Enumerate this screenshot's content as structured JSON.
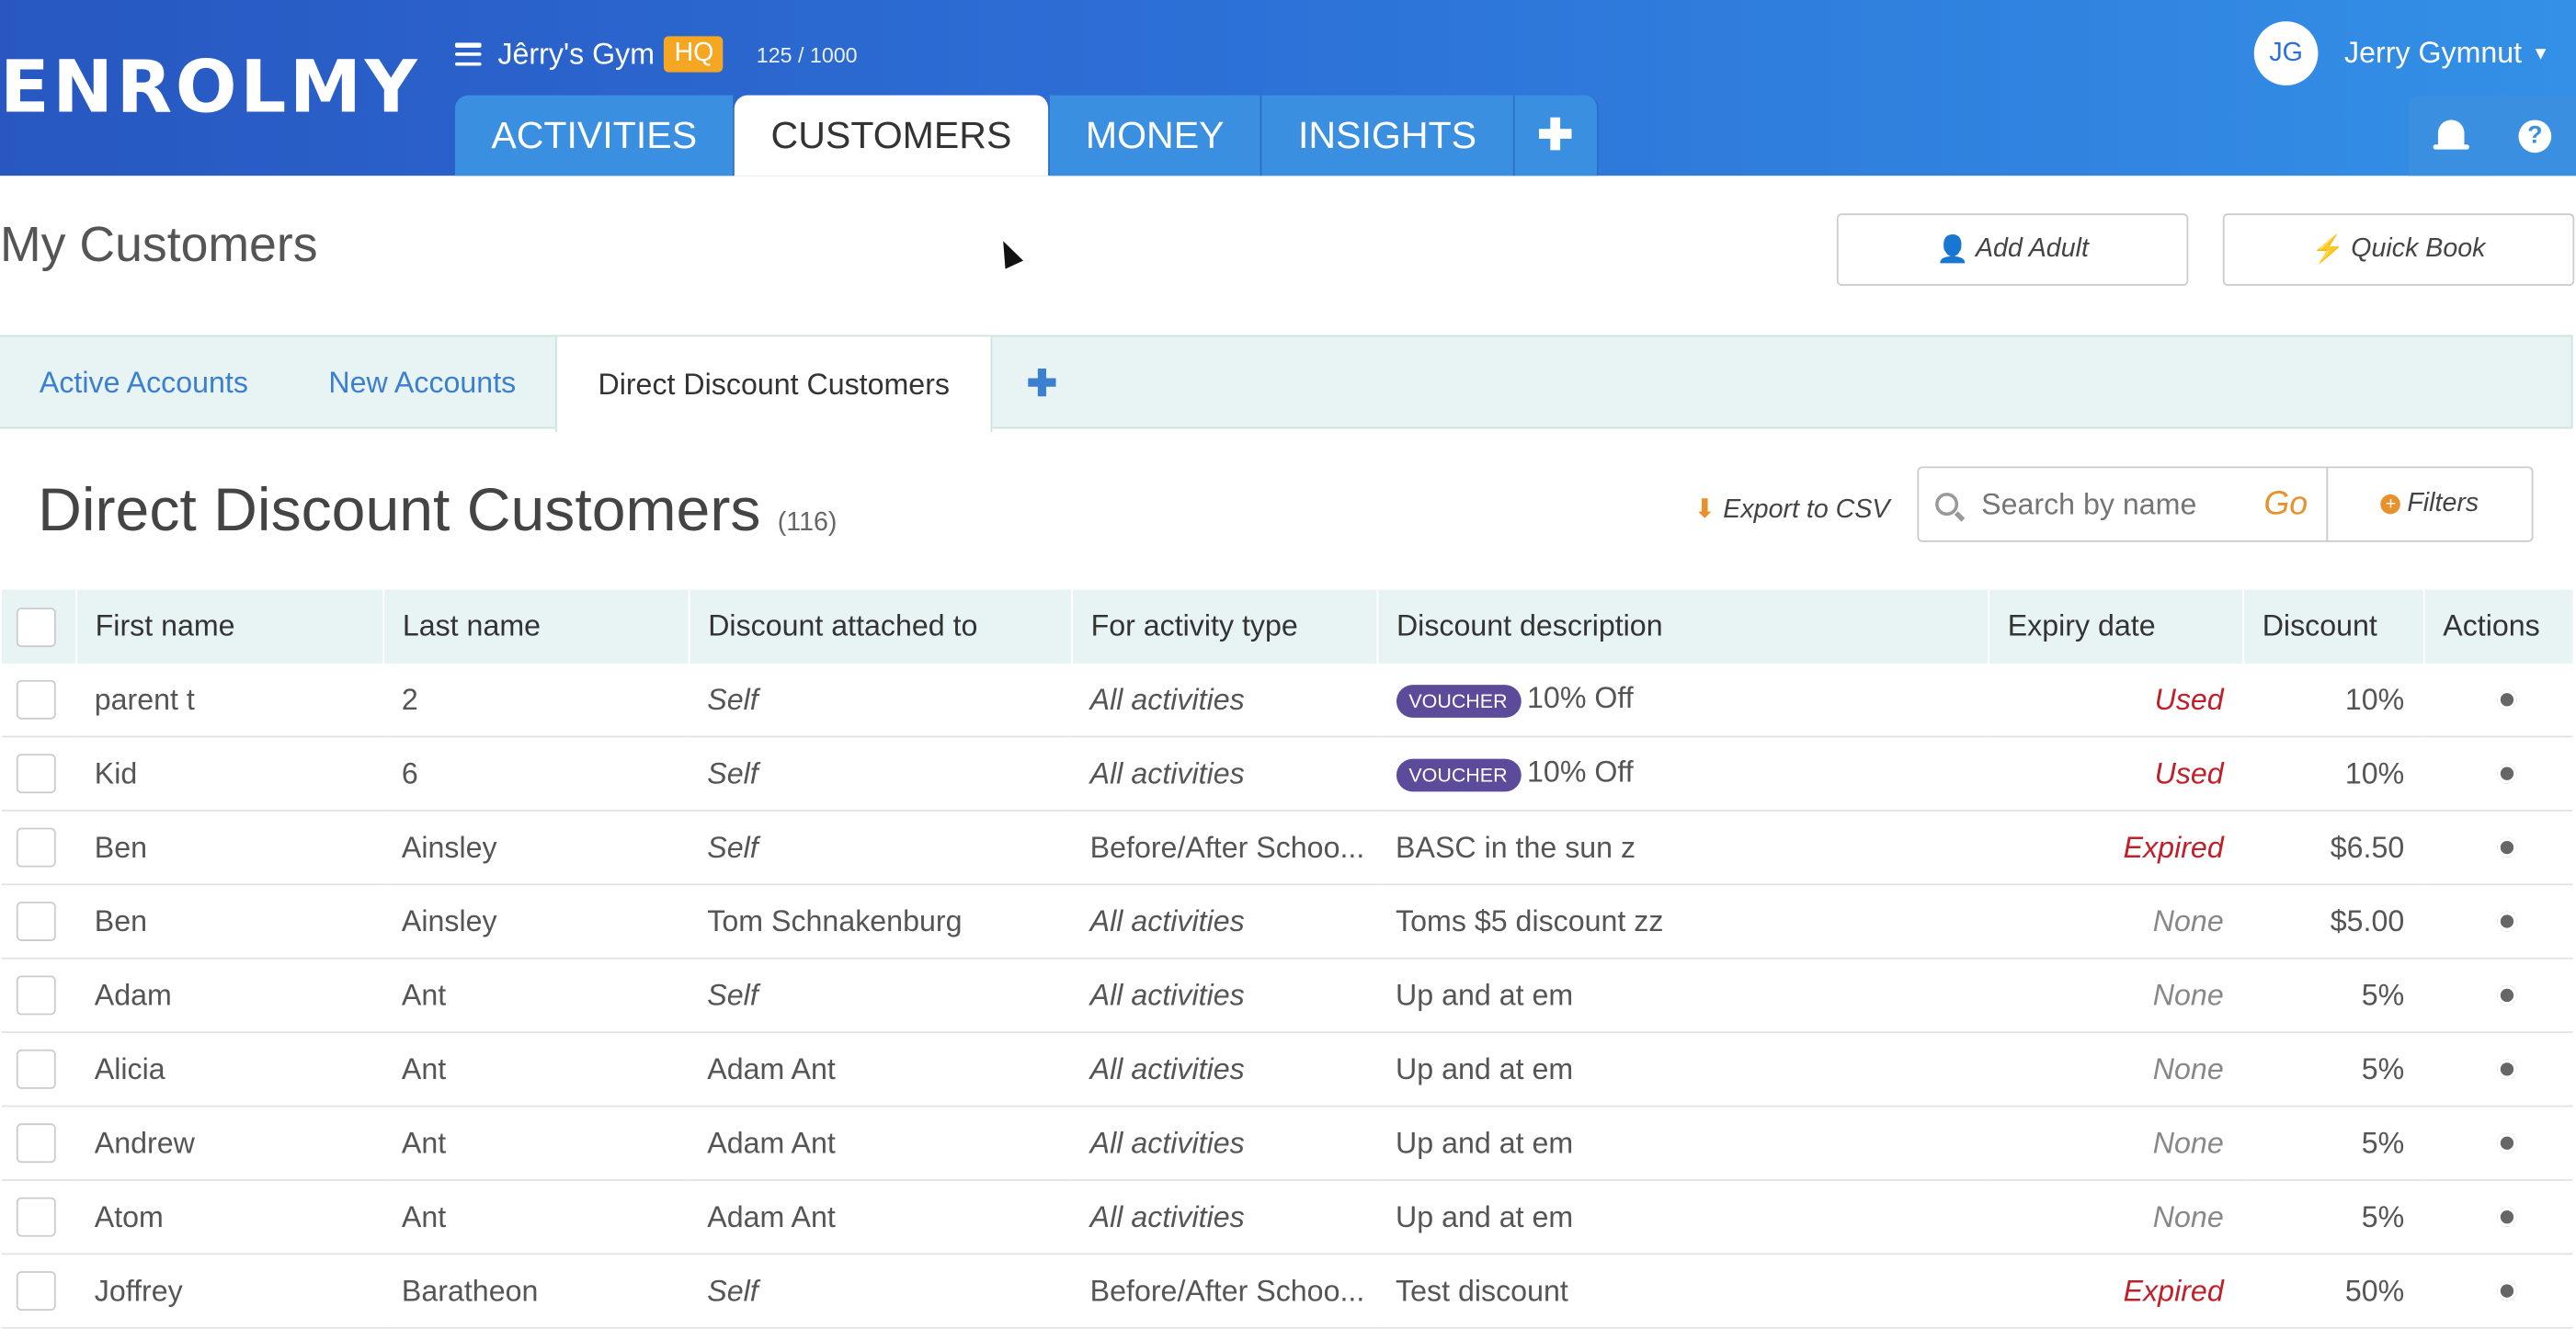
{
  "header": {
    "logo": "ENROLMY",
    "org_name": "Jêrry's Gym",
    "org_badge": "HQ",
    "quota": "125 / 1000",
    "tabs": [
      {
        "label": "ACTIVITIES"
      },
      {
        "label": "CUSTOMERS"
      },
      {
        "label": "MONEY"
      },
      {
        "label": "INSIGHTS"
      },
      {
        "label": "✚"
      }
    ],
    "user_initials": "JG",
    "user_name": "Jerry Gymnut",
    "icons": [
      "bell-icon",
      "help-icon"
    ]
  },
  "page": {
    "title": "My Customers",
    "add_adult": "Add Adult",
    "quick_book": "Quick Book"
  },
  "subtabs": [
    {
      "label": "Active Accounts"
    },
    {
      "label": "New Accounts"
    },
    {
      "label": "Direct Discount Customers"
    },
    {
      "label": "✚"
    }
  ],
  "list": {
    "title": "Direct Discount Customers",
    "count": "(116)",
    "export": "Export to CSV",
    "search_placeholder": "Search by name",
    "go": "Go",
    "filters": "Filters"
  },
  "table": {
    "headers": [
      "First name",
      "Last name",
      "Discount attached to",
      "For activity type",
      "Discount description",
      "Expiry date",
      "Discount",
      "Actions"
    ],
    "rows": [
      {
        "first": "parent t",
        "last": "2",
        "attached": "Self",
        "activity": "All activities",
        "voucher": "VOUCHER",
        "desc": "10% Off",
        "expiry": "Used",
        "discount": "10%"
      },
      {
        "first": "Kid",
        "last": "6",
        "attached": "Self",
        "activity": "All activities",
        "voucher": "VOUCHER",
        "desc": "10% Off",
        "expiry": "Used",
        "discount": "10%"
      },
      {
        "first": "Ben",
        "last": "Ainsley",
        "attached": "Self",
        "activity": "Before/After Schoo...",
        "voucher": "",
        "desc": "BASC in the sun z",
        "expiry": "Expired",
        "discount": "$6.50"
      },
      {
        "first": "Ben",
        "last": "Ainsley",
        "attached": "Tom Schnakenburg",
        "activity": "All activities",
        "voucher": "",
        "desc": "Toms $5 discount zz",
        "expiry": "None",
        "discount": "$5.00"
      },
      {
        "first": "Adam",
        "last": "Ant",
        "attached": "Self",
        "activity": "All activities",
        "voucher": "",
        "desc": "Up and at em",
        "expiry": "None",
        "discount": "5%"
      },
      {
        "first": "Alicia",
        "last": "Ant",
        "attached": "Adam Ant",
        "activity": "All activities",
        "voucher": "",
        "desc": "Up and at em",
        "expiry": "None",
        "discount": "5%"
      },
      {
        "first": "Andrew",
        "last": "Ant",
        "attached": "Adam Ant",
        "activity": "All activities",
        "voucher": "",
        "desc": "Up and at em",
        "expiry": "None",
        "discount": "5%"
      },
      {
        "first": "Atom",
        "last": "Ant",
        "attached": "Adam Ant",
        "activity": "All activities",
        "voucher": "",
        "desc": "Up and at em",
        "expiry": "None",
        "discount": "5%"
      },
      {
        "first": "Joffrey",
        "last": "Baratheon",
        "attached": "Self",
        "activity": "Before/After Schoo...",
        "voucher": "",
        "desc": "Test discount",
        "expiry": "Expired",
        "discount": "50%"
      }
    ]
  },
  "colors": {
    "brand": "#2c6fd6",
    "accent": "#e8902b",
    "status_red": "#c0202a",
    "voucher": "#5c4b9a"
  }
}
